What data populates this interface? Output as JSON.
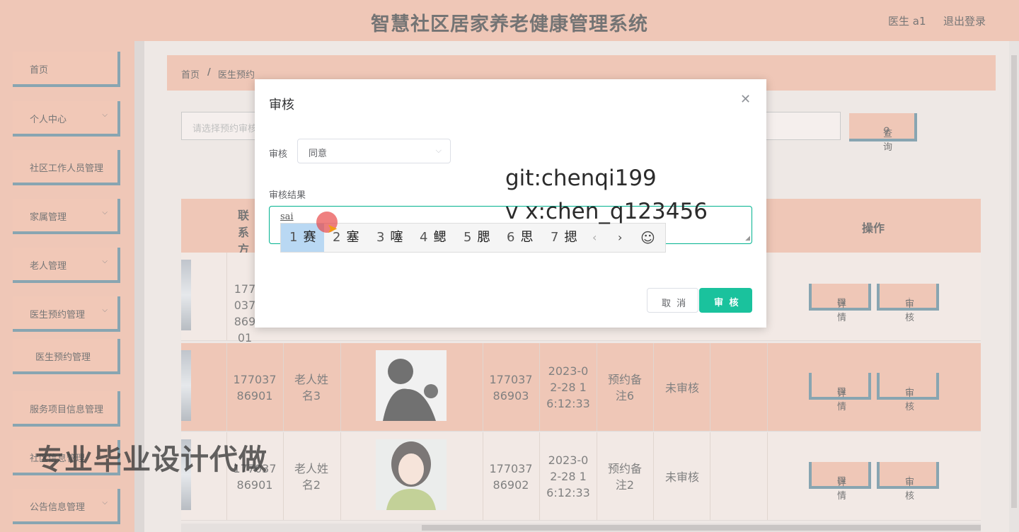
{
  "header": {
    "title": "智慧社区居家养老健康管理系统",
    "user": "医生 a1",
    "logout": "退出登录"
  },
  "sidebar": {
    "items": [
      {
        "label": "首页"
      },
      {
        "label": "个人中心",
        "expandable": true
      },
      {
        "label": "社区工作人员管理"
      },
      {
        "label": "家属管理",
        "expandable": true
      },
      {
        "label": "老人管理",
        "expandable": true
      },
      {
        "label": "医生预约管理",
        "expandable": true
      },
      {
        "label": "医生预约管理",
        "sub": true
      },
      {
        "label": "服务项目信息管理"
      },
      {
        "label": "社区信息管理"
      },
      {
        "label": "公告信息管理",
        "expandable": true
      }
    ]
  },
  "breadcrumb": {
    "home": "首页",
    "sep": "/",
    "current": "医生预约"
  },
  "search": {
    "placeholder": "请选择预约审核",
    "button": "查询"
  },
  "table": {
    "header_partial": "联系方式",
    "header_ops": "操作",
    "rows": [
      {
        "phone": "17703786901",
        "name": "",
        "phone2": "",
        "time": "",
        "note": "",
        "status": "",
        "reply": "",
        "detail": "详情",
        "audit": "审核"
      },
      {
        "phone": "17703786901",
        "name": "老人姓名3",
        "phone2": "17703786903",
        "time": "2023-02-28 16:12:33",
        "note": "预约备注6",
        "status": "未审核",
        "reply": "",
        "detail": "详情",
        "audit": "审核"
      },
      {
        "phone": "17703786901",
        "name": "老人姓名2",
        "phone2": "17703786902",
        "time": "2023-02-28 16:12:33",
        "note": "预约备注2",
        "status": "未审核",
        "reply": "",
        "detail": "详情",
        "audit": "审核"
      }
    ]
  },
  "dialog": {
    "title": "审核",
    "close_icon": "close-icon",
    "audit_label": "审核",
    "audit_value": "同意",
    "result_label": "审核结果",
    "result_typed": "sai",
    "cancel": "取 消",
    "confirm": "审 核"
  },
  "ime": {
    "candidates": [
      {
        "n": "1",
        "c": "赛"
      },
      {
        "n": "2",
        "c": "塞"
      },
      {
        "n": "3",
        "c": "噻"
      },
      {
        "n": "4",
        "c": "鳃"
      },
      {
        "n": "5",
        "c": "腮"
      },
      {
        "n": "6",
        "c": "思"
      },
      {
        "n": "7",
        "c": "揌"
      }
    ],
    "prev": "‹",
    "next": "›",
    "emoji": "☺"
  },
  "watermark": {
    "line1": "git:chenqi199",
    "line2": "v x:chen_q123456",
    "banner": "专业毕业设计代做"
  },
  "colors": {
    "accent": "#e6a58c",
    "border": "#3f6f82",
    "primary": "#1ac29d"
  }
}
